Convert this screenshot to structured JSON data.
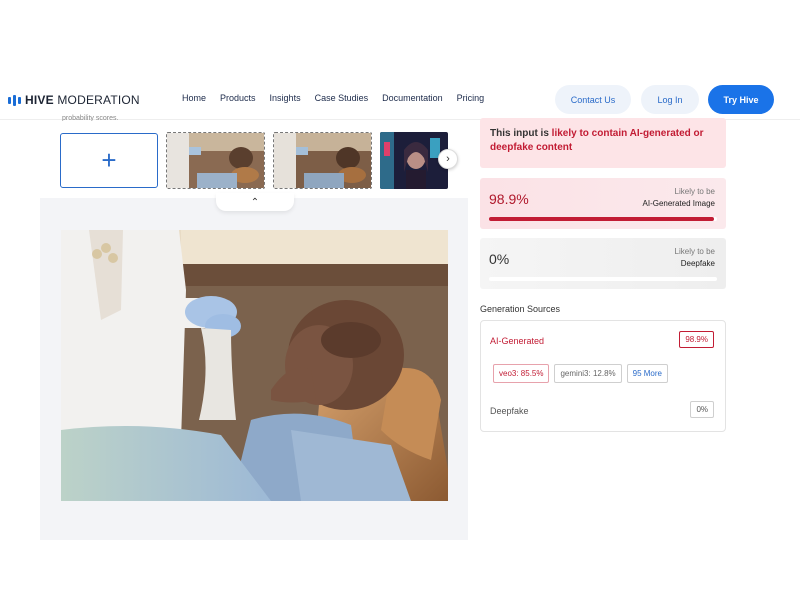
{
  "nav": {
    "logo_bold": "HIVE",
    "logo_rest": " MODERATION",
    "links": [
      "Home",
      "Products",
      "Insights",
      "Case Studies",
      "Documentation",
      "Pricing"
    ],
    "contact_label": "Contact Us",
    "login_label": "Log In",
    "try_label": "Try Hive"
  },
  "upload": {
    "clipped_text": "probability scores.",
    "add_icon": "plus-icon",
    "next_icon": "chevron-right-icon",
    "collapse_icon": "chevron-up-icon"
  },
  "result": {
    "verdict_prefix": "This input is ",
    "verdict_highlight": "likely to contain AI-generated or deepfake content",
    "ai_score": "98.9%",
    "ai_score_fraction": 0.989,
    "ai_label_top": "Likely to be",
    "ai_label_bottom": "AI-Generated Image",
    "deepfake_score": "0%",
    "deepfake_score_fraction": 0.0,
    "df_label_top": "Likely to be",
    "df_label_bottom": "Deepfake"
  },
  "sources": {
    "title": "Generation Sources",
    "ai_label": "AI-Generated",
    "ai_value": "98.9%",
    "chips": [
      "veo3: 85.5%",
      "gemini3: 12.8%",
      "95 More"
    ],
    "deepfake_label": "Deepfake",
    "deepfake_value": "0%"
  },
  "colors": {
    "accent_blue": "#1a73e8",
    "alert_red": "#c21c34",
    "alert_bg": "#fde4e7"
  }
}
